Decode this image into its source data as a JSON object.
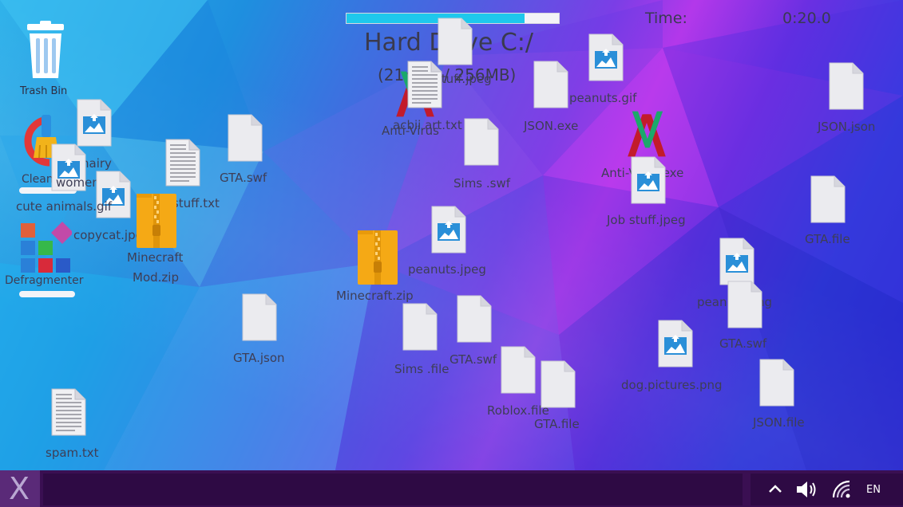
{
  "hud": {
    "title": "Hard Drive C:/",
    "capacity": "(214MB / 256MB)",
    "fill_fraction": 0.84,
    "timer_label": "Time:",
    "timer_value": "0:20.0"
  },
  "tools": {
    "trash": "Trash Bin",
    "cleaner": "Cleaner",
    "defragmenter": "Defragmenter",
    "cleaner_progress": 0.0,
    "defragmenter_progress": 0.0
  },
  "files": {
    "hairy": "hairy",
    "women_jpeg": "women.jpeg",
    "cute_animals_gif": "cute animals.gif",
    "copycat_jpeg": "copycat.jpeg",
    "job_stuff_txt": "Job stuff.txt",
    "gta_swf_1": "GTA.swf",
    "minecraft_mod_zip_line1": "Minecraft",
    "minecraft_mod_zip_line2": "Mod.zip",
    "minecraft_zip": "Minecraft.zip",
    "gta_json": "GTA.json",
    "spam_txt": "spam.txt",
    "job_stuff_jpeg_1": "Job stuff.jpeg",
    "acbii_art_txt": "acbii art.txt",
    "anti_virus_1": "Anti-Virus",
    "sims_swf": "Sims .swf",
    "peanuts_jpeg": "peanuts.jpeg",
    "sims_file": "Sims .file",
    "gta_swf_2": "GTA.swf",
    "roblox_file": "Roblox.file",
    "gta_file_1": "GTA.file",
    "peanuts_gif": "peanuts.gif",
    "json_exe": "JSON.exe",
    "anti_virus_exe": "Anti-Virus.exe",
    "job_stuff_jpeg_2": "Job stuff.jpeg",
    "peanuts_png": "peanuts.png",
    "gta_swf_3": "GTA.swf",
    "dog_pictures_png": "dog.pictures.png",
    "json_json": "JSON.json",
    "gta_file_2": "GTA.file",
    "json_file": "JSON.file"
  },
  "taskbar": {
    "language": "EN",
    "start_glyph": "X"
  },
  "colors": {
    "taskbar": "#3a0f52",
    "progress_fill": "#1ec8ec",
    "label_text": "#3e3e56",
    "zip": "#f5a915",
    "doc": "#e9e9ee",
    "image_icon": "#2a8fd8"
  }
}
